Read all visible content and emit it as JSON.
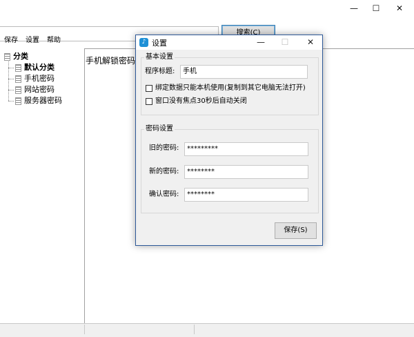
{
  "window": {
    "controls": {
      "minimize": "—",
      "maximize": "☐",
      "close": "✕"
    }
  },
  "menu": {
    "items": [
      "保存",
      "设置",
      "帮助"
    ]
  },
  "toolbar": {
    "search_label": "搜索(C)"
  },
  "tree": {
    "root": "分类",
    "children": [
      "默认分类",
      "手机密码",
      "网站密码",
      "服务器密码"
    ]
  },
  "content": {
    "preview_text": "手机解锁密码"
  },
  "dialog": {
    "title": "设置",
    "icon_glyph": "♪",
    "controls": {
      "minimize": "—",
      "maximize": "☐",
      "close": "✕"
    },
    "basic": {
      "legend": "基本设置",
      "title_label": "程序标题:",
      "title_value": "手机",
      "bind_label": "绑定数据只能本机使用(复制到其它电脑无法打开)",
      "bind_checked": false,
      "autoclose_label": "窗口没有焦点30秒后自动关闭",
      "autoclose_checked": false
    },
    "password": {
      "legend": "密码设置",
      "old_label": "旧的密码:",
      "old_value": "*********",
      "new_label": "新的密码:",
      "new_value": "********",
      "confirm_label": "确认密码:",
      "confirm_value": "********"
    },
    "save_label": "保存(S)"
  },
  "colors": {
    "dialog_border": "#2b5797",
    "app_icon": "#1e90d6",
    "focus_border": "#3c7fb1"
  }
}
